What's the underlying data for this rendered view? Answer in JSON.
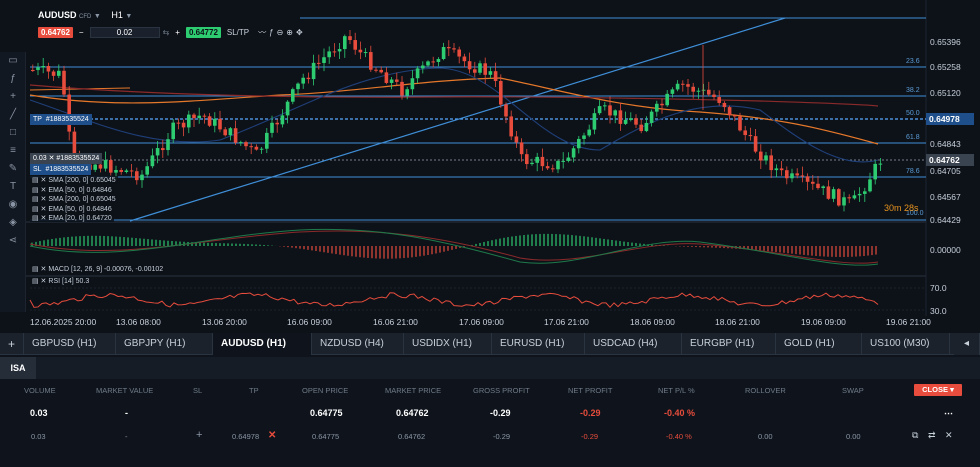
{
  "header": {
    "symbol": "AUDUSD",
    "symbol_suffix": "CFD",
    "timeframe": "H1",
    "sell_price": "0.64762",
    "volume_value": "0.02",
    "buy_price": "0.64772",
    "sltp_label": "SL/TP"
  },
  "price_axis": [
    "0.65396",
    "0.65258",
    "0.65120",
    "0.64978",
    "0.64843",
    "0.64762",
    "0.64705",
    "0.64567",
    "0.64429"
  ],
  "fib_levels": [
    "23.6",
    "38.2",
    "50.0",
    "61.8",
    "78.6",
    "100.0"
  ],
  "macd_axis": "0.00000",
  "rsi_axis": [
    "70.0",
    "30.0"
  ],
  "time_axis": [
    "12.06.2025 20:00",
    "13.06 08:00",
    "13.06 20:00",
    "16.06 09:00",
    "16.06 21:00",
    "17.06 09:00",
    "17.06 21:00",
    "18.06 09:00",
    "18.06 21:00",
    "19.06 09:00",
    "19.06 21:00"
  ],
  "tp_tag": {
    "label": "TP",
    "order": "#1883535524"
  },
  "sl_tag": {
    "label": "SL",
    "order": "#1883535524"
  },
  "pos_tag": {
    "label": "0.03",
    "order": "#1883535524"
  },
  "legend": [
    "SMA [200, 0] 0.65045",
    "EMA [50, 0] 0.64846",
    "SMA [200, 0] 0.65045",
    "EMA [50, 0] 0.64846",
    "EMA [20, 0] 0.64720"
  ],
  "macd_label": "MACD [12, 26, 9] -0.00076, -0.00102",
  "rsi_label": "RSI [14] 50.3",
  "countdown": "30m 28s",
  "tabs": [
    "GBPUSD (H1)",
    "GBPJPY (H1)",
    "AUDUSD (H1)",
    "NZDUSD (H4)",
    "USDIDX (H1)",
    "EURUSD (H1)",
    "USDCAD (H4)",
    "EURGBP (H1)",
    "GOLD (H1)",
    "US100 (M30)"
  ],
  "active_tab": "AUDUSD (H1)",
  "account_tab": "ISA",
  "positions": {
    "headers": [
      "VOLUME",
      "MARKET VALUE",
      "SL",
      "TP",
      "OPEN PRICE",
      "MARKET PRICE",
      "GROSS PROFIT",
      "NET PROFIT",
      "NET P/L %",
      "ROLLOVER",
      "SWAP"
    ],
    "close_label": "CLOSE",
    "summary": {
      "volume": "0.03",
      "market_value": "-",
      "open_price": "0.64775",
      "market_price": "0.64762",
      "gross_profit": "-0.29",
      "net_profit": "-0.29",
      "net_pl": "-0.40 %"
    },
    "row": {
      "volume": "0.03",
      "market_value": "-",
      "sl": "+",
      "tp": "0.64978",
      "open_price": "0.64775",
      "market_price": "0.64762",
      "gross_profit": "-0.29",
      "net_profit": "-0.29",
      "net_pl": "-0.40 %",
      "rollover": "0.00",
      "swap": "0.00"
    }
  },
  "colors": {
    "bull": "#2ecc71",
    "bear": "#e74c3c",
    "blue_line": "#3f8fd8",
    "orange": "#e6782a",
    "bg": "#0d1219"
  }
}
